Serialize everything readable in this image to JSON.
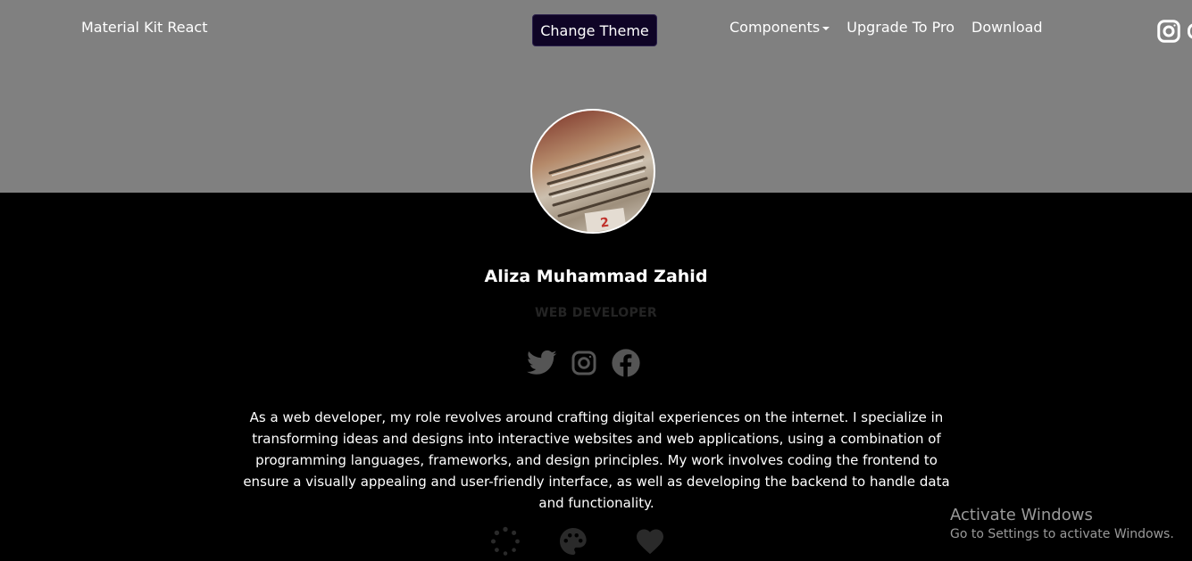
{
  "navbar": {
    "brand": "Material Kit React",
    "theme_button": "Change Theme",
    "items": [
      {
        "label": "Components",
        "has_dropdown": true
      },
      {
        "label": "Upgrade To Pro"
      },
      {
        "label": "Download"
      }
    ],
    "icons": [
      "instagram-icon"
    ]
  },
  "profile": {
    "name": "Aliza Muhammad Zahid",
    "title": "WEB DEVELOPER",
    "social_icons": [
      "twitter-icon",
      "instagram-icon",
      "facebook-icon"
    ],
    "bio": "As a web developer, my role revolves around crafting digital experiences on the internet. I specialize in transforming ideas and designs into interactive websites and web applications, using a combination of programming languages, frameworks, and design principles. My work involves coding the frontend to ensure a visually appealing and user-friendly interface, as well as developing the backend to handle data and functionality."
  },
  "tabs_icons": [
    "loading-icon",
    "palette-icon",
    "heart-icon"
  ],
  "watermark": {
    "line1": "Activate Windows",
    "line2": "Go to Settings to activate Windows."
  },
  "colors": {
    "hero_bg": "#808080",
    "main_bg": "#000000",
    "theme_button_bg": "#0f0426"
  }
}
